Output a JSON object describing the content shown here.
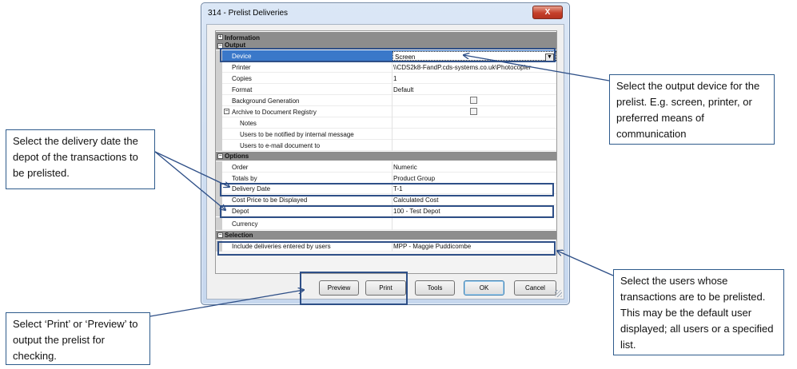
{
  "window": {
    "title": "314 - Prelist Deliveries",
    "close_glyph": "X"
  },
  "sections": {
    "information": "Information",
    "output": "Output",
    "options": "Options",
    "selection": "Selection"
  },
  "output_rows": {
    "device": {
      "name": "Device",
      "value": "Screen"
    },
    "printer": {
      "name": "Printer",
      "value": "\\\\CDS2k8-FandP.cds-systems.co.uk\\Photocopier"
    },
    "copies": {
      "name": "Copies",
      "value": "1"
    },
    "format": {
      "name": "Format",
      "value": "Default"
    },
    "background_generation": {
      "name": "Background Generation",
      "checked": false
    },
    "archive": {
      "name": "Archive to Document Registry",
      "checked": false
    },
    "notes": {
      "name": "Notes"
    },
    "notify_users": {
      "name": "Users to be notified by internal message"
    },
    "email_users": {
      "name": "Users to e-mail document to"
    }
  },
  "options_rows": {
    "order": {
      "name": "Order",
      "value": "Numeric"
    },
    "totals_by": {
      "name": "Totals by",
      "value": "Product Group"
    },
    "delivery_date": {
      "name": "Delivery Date",
      "value": "T-1"
    },
    "cost_price": {
      "name": "Cost Price to be Displayed",
      "value": "Calculated Cost"
    },
    "depot": {
      "name": "Depot",
      "value": "100 - Test Depot"
    },
    "currency": {
      "name": "Currency",
      "value": ""
    }
  },
  "selection_rows": {
    "include_users": {
      "name": "Include deliveries entered by users",
      "value": "MPP - Maggie Puddicombe"
    }
  },
  "buttons": {
    "preview": "Preview",
    "print": "Print",
    "tools": "Tools",
    "ok": "OK",
    "cancel": "Cancel"
  },
  "callouts": {
    "delivery": "Select the delivery date the depot of the transactions to be prelisted.",
    "print": "Select ‘Print’ or ‘Preview’ to output the prelist for checking.",
    "device": "Select the output device for the prelist. E.g. screen, printer, or preferred means of communication",
    "users": "Select the users whose transactions are to be prelisted. This may be the default user displayed; all users or a specified list."
  },
  "colors": {
    "annotation": "#2e4f87",
    "selected_row": "#3a78c9",
    "category_row": "#8d8d8d"
  }
}
